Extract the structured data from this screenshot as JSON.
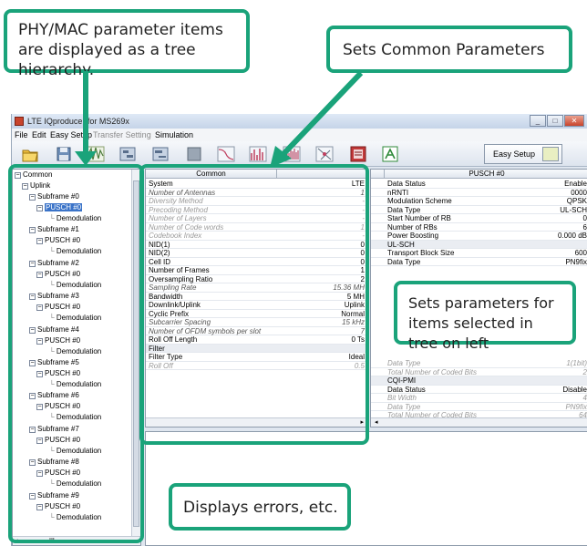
{
  "window": {
    "title": "LTE IQproducer for MS269x",
    "buttons": [
      "_",
      "□",
      "✕"
    ]
  },
  "menu": {
    "file": "File",
    "edit": "Edit",
    "easy_setup": "Easy Setup",
    "transfer_setting": "Transfer Setting",
    "simulation": "Simulation"
  },
  "toolbar": {
    "icons": [
      "open-icon",
      "save-icon",
      "waveform-icon",
      "ofdm-icon",
      "ofdm-ul-icon",
      "stop-icon",
      "ccdf-icon",
      "fft-icon",
      "time-domain-icon",
      "constellation-icon",
      "calc-icon",
      "export-icon"
    ],
    "easy_setup_label": "Easy Setup"
  },
  "tree": {
    "root": "Common",
    "uplink": "Uplink",
    "subframes": [
      "Subframe #0",
      "Subframe #1",
      "Subframe #2",
      "Subframe #3",
      "Subframe #4",
      "Subframe #5",
      "Subframe #6",
      "Subframe #7",
      "Subframe #8",
      "Subframe #9"
    ],
    "pusch": "PUSCH #0",
    "demodulation": "Demodulation",
    "h_scroll_label": "III"
  },
  "common": {
    "header": "Common",
    "rows": [
      {
        "label": "System",
        "value": "LTE",
        "style": "normal"
      },
      {
        "label": "Number of Antennas",
        "value": "1",
        "style": "italic"
      },
      {
        "label": "Diversity Method",
        "value": "-",
        "style": "gray"
      },
      {
        "label": "Precoding Method",
        "value": "-",
        "style": "gray"
      },
      {
        "label": "Number of Layers",
        "value": "-",
        "style": "gray"
      },
      {
        "label": "Number of Code words",
        "value": "1",
        "style": "gray"
      },
      {
        "label": "Codebook Index",
        "value": "-",
        "style": "gray"
      },
      {
        "label": "NID(1)",
        "value": "0",
        "style": "normal"
      },
      {
        "label": "NID(2)",
        "value": "0",
        "style": "normal"
      },
      {
        "label": "Cell ID",
        "value": "0",
        "style": "normal"
      },
      {
        "label": "Number of Frames",
        "value": "1",
        "style": "normal"
      },
      {
        "label": "Oversampling Ratio",
        "value": "2",
        "style": "normal"
      },
      {
        "label": "Sampling Rate",
        "value": "15.36 MH",
        "style": "italic"
      },
      {
        "label": "Bandwidth",
        "value": "5 MH",
        "style": "normal"
      },
      {
        "label": "Downlink/Uplink",
        "value": "Uplink",
        "style": "normal"
      },
      {
        "label": "Cyclic Prefix",
        "value": "Normal",
        "style": "normal"
      },
      {
        "label": "Subcarrier Spacing",
        "value": "15 kHz",
        "style": "italic"
      },
      {
        "label": "Number of OFDM symbols per slot",
        "value": "7",
        "style": "italic"
      },
      {
        "label": "Roll Off Length",
        "value": "0 Ts",
        "style": "normal"
      },
      {
        "label": "Filter",
        "value": "",
        "style": "section"
      },
      {
        "label": "Filter Type",
        "value": "Ideal",
        "style": "normal"
      },
      {
        "label": "Roll Off",
        "value": "0.5",
        "style": "gray"
      }
    ]
  },
  "pusch": {
    "header": "PUSCH #0",
    "rows": [
      {
        "label": "Data Status",
        "value": "Enable",
        "style": "normal"
      },
      {
        "label": "nRNTI",
        "value": "0000",
        "style": "normal"
      },
      {
        "label": "Modulation Scheme",
        "value": "QPSK",
        "style": "normal"
      },
      {
        "label": "Data Type",
        "value": "UL-SCH",
        "style": "normal"
      },
      {
        "label": "Start Number of RB",
        "value": "0",
        "style": "normal"
      },
      {
        "label": "Number of RBs",
        "value": "6",
        "style": "normal"
      },
      {
        "label": "Power Boosting",
        "value": "0.000 dB",
        "style": "normal"
      },
      {
        "label": "UL-SCH",
        "value": "",
        "style": "section"
      },
      {
        "label": "Transport Block Size",
        "value": "600",
        "style": "normal"
      },
      {
        "label": "Data Type",
        "value": "PN9fix",
        "style": "normal"
      }
    ],
    "lower_rows": [
      {
        "label": "Data Type",
        "value": "1(1bit)",
        "style": "gray"
      },
      {
        "label": "Total Number of Coded Bits",
        "value": "2",
        "style": "gray"
      },
      {
        "label": "CQI-PMI",
        "value": "",
        "style": "section"
      },
      {
        "label": "Data Status",
        "value": "Disable",
        "style": "normal"
      },
      {
        "label": "Bit Width",
        "value": "4",
        "style": "gray"
      },
      {
        "label": "Data Type",
        "value": "PN9fix",
        "style": "gray"
      },
      {
        "label": "Total Number of Coded Bits",
        "value": "64",
        "style": "gray"
      }
    ]
  },
  "callouts": {
    "tree": "PHY/MAC parameter items are displayed as a tree hierarchy.",
    "common": "Sets Common Parameters",
    "items": "Sets parameters for items selected in tree on left",
    "errors": "Displays errors, etc."
  },
  "colors": {
    "callout_border": "#1aa37a",
    "selection": "#3a73c8"
  }
}
